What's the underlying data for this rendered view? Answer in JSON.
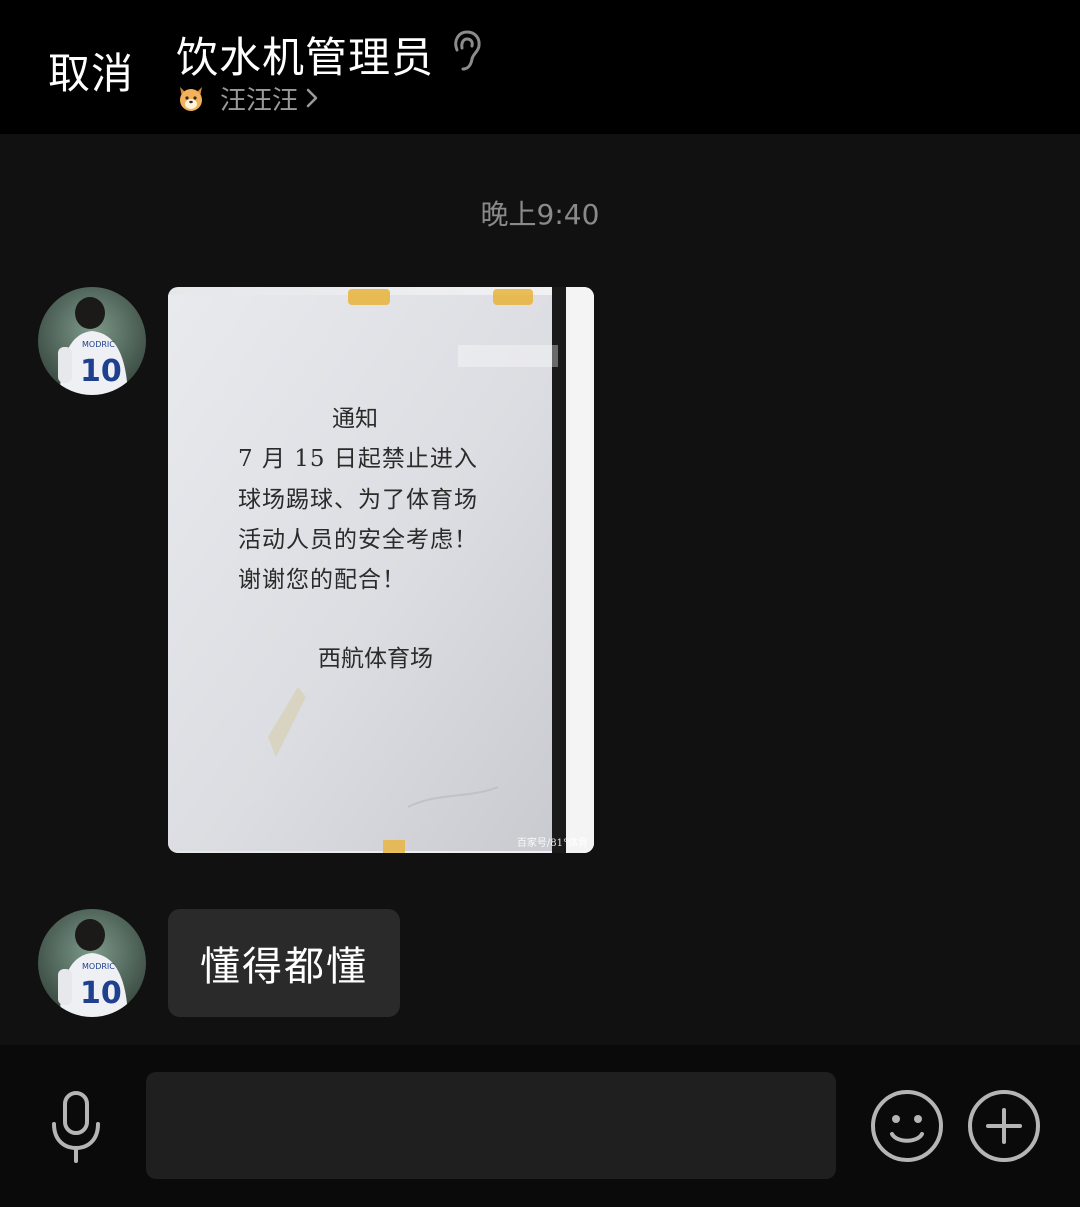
{
  "header": {
    "cancel_label": "取消",
    "title": "饮水机管理员",
    "title_icon": "ear-icon",
    "subtitle": "汪汪汪",
    "subtitle_icon": "dog-emoji-icon"
  },
  "chat": {
    "timestamp": "晚上9:40",
    "messages": [
      {
        "type": "image",
        "sender_avatar": "avatar-soccer-player",
        "notice": {
          "title": "通知",
          "lines": [
            "7 月 15 日起禁止进入",
            "球场踢球、为了体育场",
            "活动人员的安全考虑！",
            "谢谢您的配合！"
          ],
          "signature": "西航体育场",
          "watermark": "百家号/81°体育"
        }
      },
      {
        "type": "text",
        "sender_avatar": "avatar-soccer-player",
        "text": "懂得都懂"
      }
    ]
  },
  "input_bar": {
    "placeholder": "",
    "value": "",
    "icons": [
      "microphone-icon",
      "emoji-icon",
      "plus-icon"
    ]
  },
  "colors": {
    "background": "#111111",
    "header_background": "#000000",
    "bubble_background": "#2a2a2a",
    "input_background": "#1f1f1f",
    "secondary_text": "#8a8a8a"
  }
}
